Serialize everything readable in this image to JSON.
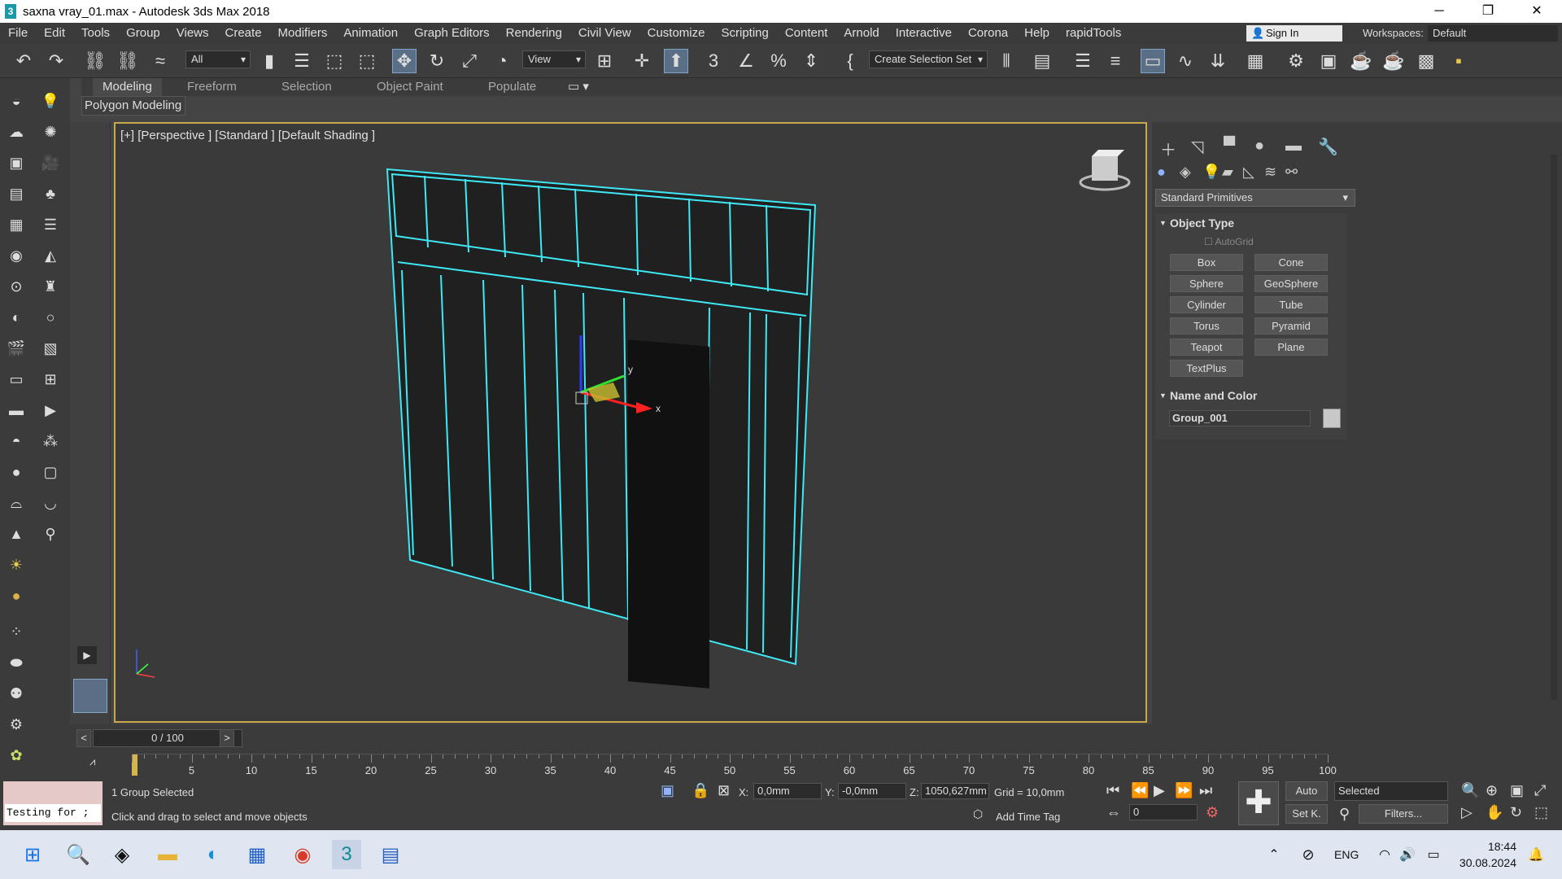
{
  "window": {
    "title": "saxna vray_01.max - Autodesk 3ds Max 2018",
    "app_icon_letter": "3"
  },
  "menu": [
    "File",
    "Edit",
    "Tools",
    "Group",
    "Views",
    "Create",
    "Modifiers",
    "Animation",
    "Graph Editors",
    "Rendering",
    "Civil View",
    "Customize",
    "Scripting",
    "Content",
    "Arnold",
    "Interactive",
    "Corona",
    "Help",
    "rapidTools"
  ],
  "account": {
    "sign_in": "Sign In",
    "workspaces_label": "Workspaces:",
    "workspace": "Default"
  },
  "toolbar": {
    "filter": "All",
    "ref_coord": "View",
    "selection_set": "Create Selection Set",
    "snap_label": "3"
  },
  "ribbon": {
    "tabs": [
      "Modeling",
      "Freeform",
      "Selection",
      "Object Paint",
      "Populate"
    ],
    "active": "Modeling",
    "panel": "Polygon Modeling"
  },
  "viewport": {
    "label": "[+] [Perspective ] [Standard ] [Default Shading ]",
    "accent": "#c9a84d",
    "wire_color": "#3ee8f4"
  },
  "command_panel": {
    "dropdown": "Standard Primitives",
    "object_type": {
      "title": "Object Type",
      "autogrid": "AutoGrid",
      "buttons": [
        "Box",
        "Cone",
        "Sphere",
        "GeoSphere",
        "Cylinder",
        "Tube",
        "Torus",
        "Pyramid",
        "Teapot",
        "Plane",
        "TextPlus"
      ]
    },
    "name_color": {
      "title": "Name and Color",
      "name": "Group_001",
      "color": "#c8c8c8"
    }
  },
  "timeline": {
    "frame": "0 / 100",
    "ticks": [
      "5",
      "10",
      "15",
      "20",
      "25",
      "30",
      "35",
      "40",
      "45",
      "50",
      "55",
      "60",
      "65",
      "70",
      "75",
      "80",
      "85",
      "90",
      "95",
      "100"
    ]
  },
  "status": {
    "maxscript": "Testing for ;",
    "selection": "1 Group Selected",
    "prompt": "Click and drag to select and move objects",
    "x_label": "X:",
    "x": "0,0mm",
    "y_label": "Y:",
    "y": "-0,0mm",
    "z_label": "Z:",
    "z": "1050,627mm",
    "grid": "Grid = 10,0mm",
    "add_time_tag": "Add Time Tag",
    "auto": "Auto",
    "set_key": "Set K.",
    "key_filter": "Selected",
    "filters": "Filters...",
    "frame_field": "0"
  },
  "taskbar": {
    "lang": "ENG",
    "time": "18:44",
    "date": "30.08.2024"
  }
}
